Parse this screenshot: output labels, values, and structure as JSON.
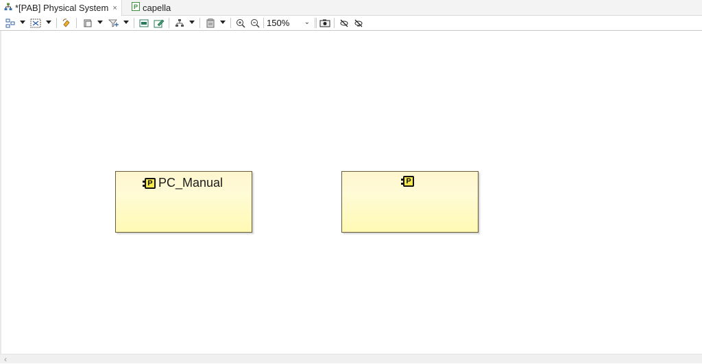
{
  "tabs": [
    {
      "label": "*[PAB] Physical System",
      "icon": "diagram-tree-icon",
      "active": true,
      "close": "×"
    },
    {
      "label": "capella",
      "icon": "capella-project-icon",
      "active": false
    }
  ],
  "toolbar": {
    "zoom": "150%",
    "zoom_chevron": "⌄"
  },
  "diagram": {
    "nodes": [
      {
        "label": "PC_Manual",
        "icon": "physical-component-icon",
        "icon_glyph": "P"
      },
      {
        "label": "",
        "icon": "physical-component-icon",
        "icon_glyph": "P"
      }
    ]
  },
  "scrollbar": {
    "left_arrow": "‹"
  },
  "colors": {
    "node_fill": "#fff9b3",
    "node_border": "#6b5a3a",
    "icon_yellow": "#f5e84a"
  }
}
